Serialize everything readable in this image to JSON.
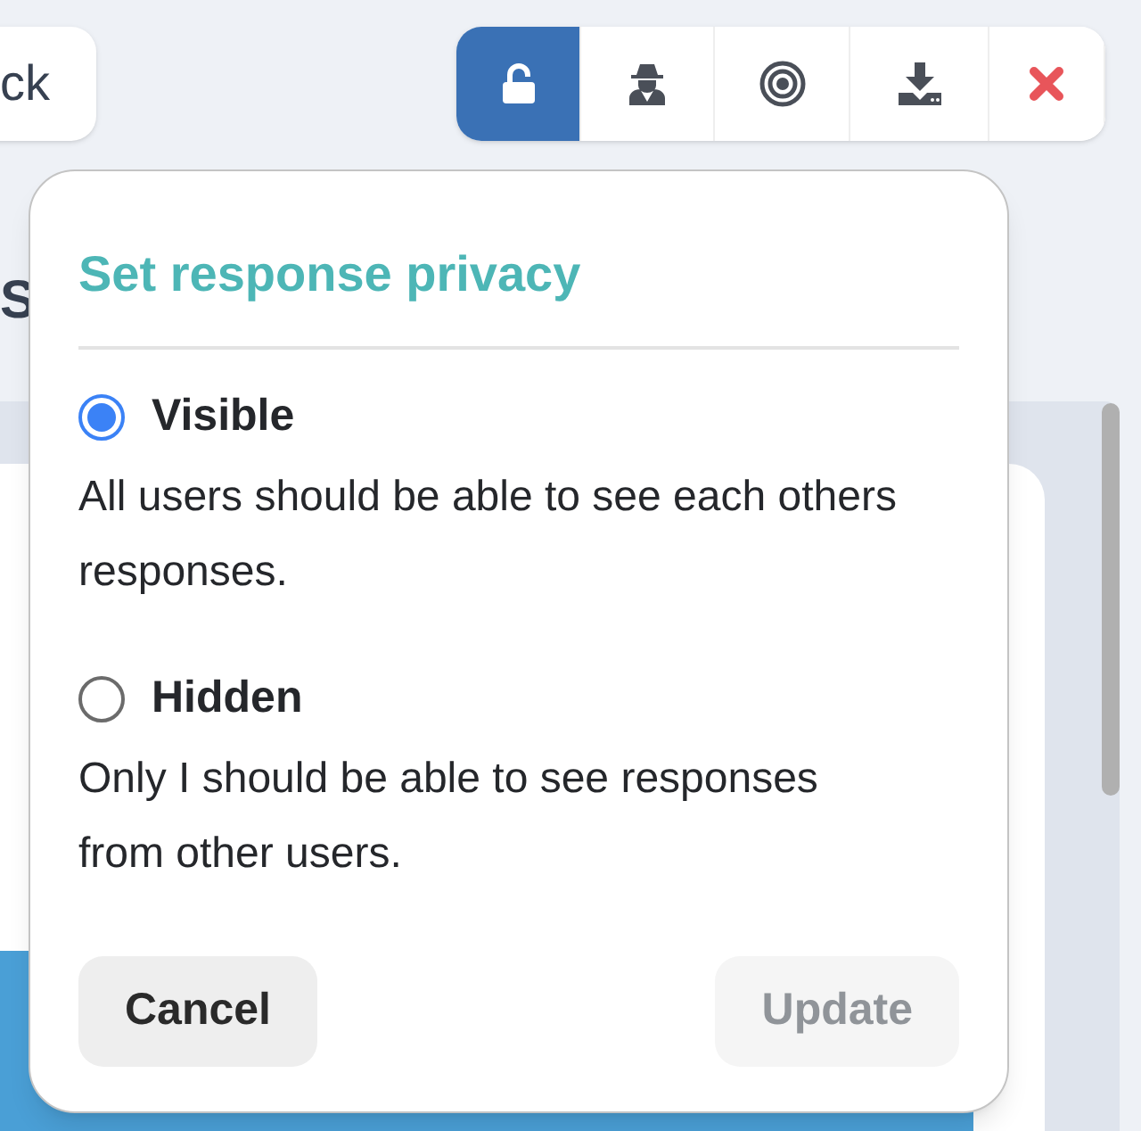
{
  "back_button": {
    "label": "ck"
  },
  "toolbar": [
    {
      "kind": "unlock",
      "selected": true
    },
    {
      "kind": "spy",
      "selected": false
    },
    {
      "kind": "target",
      "selected": false
    },
    {
      "kind": "download",
      "selected": false
    },
    {
      "kind": "close",
      "selected": false
    }
  ],
  "page_heading": "S",
  "privacy_dialog": {
    "title": "Set response privacy",
    "options": [
      {
        "label": "Visible",
        "description": "All users should be able to see each others responses.",
        "selected": true
      },
      {
        "label": "Hidden",
        "description": "Only I should be able to see responses from other users.",
        "selected": false
      }
    ],
    "buttons": [
      {
        "label": "Cancel",
        "disabled": false
      },
      {
        "label": "Update",
        "disabled": true
      }
    ]
  }
}
